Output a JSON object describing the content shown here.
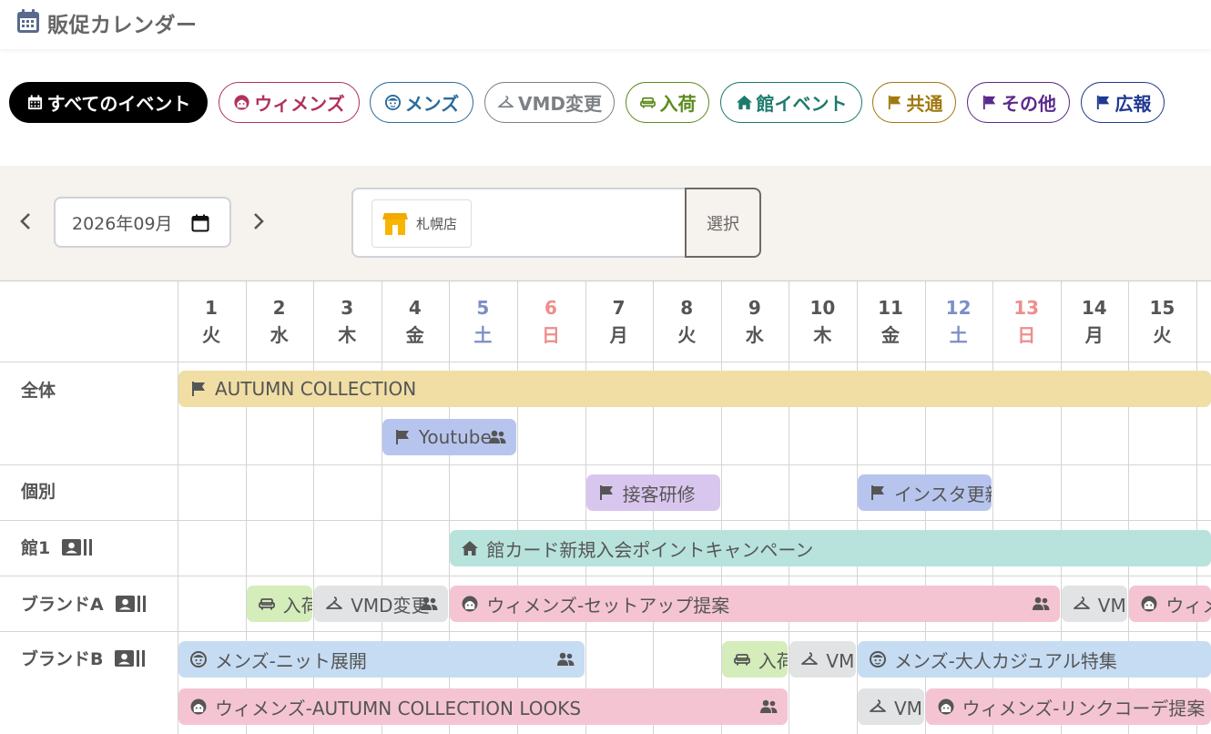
{
  "header": {
    "title": "販促カレンダー",
    "icon": "calendar-icon"
  },
  "filters": [
    {
      "label": "すべてのイベント",
      "icon": "calendar-icon",
      "color": "#000000",
      "active": true
    },
    {
      "label": "ウィメンズ",
      "icon": "woman-face-icon",
      "color": "#b0325f"
    },
    {
      "label": "メンズ",
      "icon": "man-face-icon",
      "color": "#2a6c9e"
    },
    {
      "label": "VMD変更",
      "icon": "hanger-icon",
      "color": "#7d8185"
    },
    {
      "label": "入荷",
      "icon": "sofa-icon",
      "color": "#5c8a1e"
    },
    {
      "label": "館イベント",
      "icon": "house-icon",
      "color": "#1d7a6c"
    },
    {
      "label": "共通",
      "icon": "flag-icon",
      "color": "#a07a10"
    },
    {
      "label": "その他",
      "icon": "flag-icon",
      "color": "#5b2a8c"
    },
    {
      "label": "広報",
      "icon": "flag-icon",
      "color": "#203a90"
    }
  ],
  "toolbar": {
    "month": "2026年09月",
    "store": "札幌店",
    "select_label": "選択"
  },
  "days": [
    {
      "num": "1",
      "dow": "火",
      "type": "weekday"
    },
    {
      "num": "2",
      "dow": "水",
      "type": "weekday"
    },
    {
      "num": "3",
      "dow": "木",
      "type": "weekday"
    },
    {
      "num": "4",
      "dow": "金",
      "type": "weekday"
    },
    {
      "num": "5",
      "dow": "土",
      "type": "sat"
    },
    {
      "num": "6",
      "dow": "日",
      "type": "sun"
    },
    {
      "num": "7",
      "dow": "月",
      "type": "weekday"
    },
    {
      "num": "8",
      "dow": "火",
      "type": "weekday"
    },
    {
      "num": "9",
      "dow": "水",
      "type": "weekday"
    },
    {
      "num": "10",
      "dow": "木",
      "type": "weekday"
    },
    {
      "num": "11",
      "dow": "金",
      "type": "weekday"
    },
    {
      "num": "12",
      "dow": "土",
      "type": "sat"
    },
    {
      "num": "13",
      "dow": "日",
      "type": "sun"
    },
    {
      "num": "14",
      "dow": "月",
      "type": "weekday"
    },
    {
      "num": "15",
      "dow": "火",
      "type": "weekday"
    }
  ],
  "rows": [
    {
      "label": "全体",
      "has_icon": false
    },
    {
      "label": "個別",
      "has_icon": false
    },
    {
      "label": "館1",
      "has_icon": true
    },
    {
      "label": "ブランドA",
      "has_icon": true
    },
    {
      "label": "ブランドB",
      "has_icon": true
    }
  ],
  "events": [
    {
      "row": 0,
      "lane": 0,
      "start": 1,
      "end": 16,
      "label": "AUTUMN COLLECTION",
      "icon": "flag-icon",
      "color": "#f0dea4",
      "people": false
    },
    {
      "row": 0,
      "lane": 1,
      "start": 4,
      "end": 5,
      "label": "Youtube",
      "icon": "flag-icon",
      "color": "#b7c5ee",
      "people": true
    },
    {
      "row": 1,
      "lane": 0,
      "start": 7,
      "end": 8,
      "label": "接客研修",
      "icon": "flag-icon",
      "color": "#d9c6ee",
      "people": false
    },
    {
      "row": 1,
      "lane": 0,
      "start": 11,
      "end": 12,
      "label": "インスタ更新",
      "icon": "flag-icon",
      "color": "#b7c5ee",
      "people": false
    },
    {
      "row": 2,
      "lane": 0,
      "start": 5,
      "end": 16,
      "label": "館カード新規入会ポイントキャンペーン",
      "icon": "house-icon",
      "color": "#b8e3dd",
      "people": false
    },
    {
      "row": 3,
      "lane": 0,
      "start": 2,
      "end": 2,
      "label": "入荷",
      "icon": "sofa-icon",
      "color": "#d4edbb",
      "people": false
    },
    {
      "row": 3,
      "lane": 0,
      "start": 3,
      "end": 4,
      "label": "VMD変更",
      "icon": "hanger-icon",
      "color": "#e2e3e5",
      "people": true
    },
    {
      "row": 3,
      "lane": 0,
      "start": 5,
      "end": 13,
      "label": "ウィメンズ-セットアップ提案",
      "icon": "woman-face-icon",
      "color": "#f5c4d3",
      "people": true
    },
    {
      "row": 3,
      "lane": 0,
      "start": 14,
      "end": 14,
      "label": "VMD変更",
      "icon": "hanger-icon",
      "color": "#e2e3e5",
      "people": false
    },
    {
      "row": 3,
      "lane": 0,
      "start": 15,
      "end": 16,
      "label": "ウィメンズ",
      "icon": "woman-face-icon",
      "color": "#f5c4d3",
      "people": false
    },
    {
      "row": 4,
      "lane": 0,
      "start": 1,
      "end": 6,
      "label": "メンズ-ニット展開",
      "icon": "man-face-icon",
      "color": "#c6dcf3",
      "people": true
    },
    {
      "row": 4,
      "lane": 0,
      "start": 9,
      "end": 9,
      "label": "入荷",
      "icon": "sofa-icon",
      "color": "#d4edbb",
      "people": false
    },
    {
      "row": 4,
      "lane": 0,
      "start": 10,
      "end": 10,
      "label": "VMD変更",
      "icon": "hanger-icon",
      "color": "#e2e3e5",
      "people": false
    },
    {
      "row": 4,
      "lane": 0,
      "start": 11,
      "end": 16,
      "label": "メンズ-大人カジュアル特集",
      "icon": "man-face-icon",
      "color": "#c6dcf3",
      "people": false
    },
    {
      "row": 4,
      "lane": 1,
      "start": 1,
      "end": 9,
      "label": "ウィメンズ-AUTUMN COLLECTION LOOKS",
      "icon": "woman-face-icon",
      "color": "#f5c4d3",
      "people": true
    },
    {
      "row": 4,
      "lane": 1,
      "start": 11,
      "end": 11,
      "label": "VMD変更",
      "icon": "hanger-icon",
      "color": "#e2e3e5",
      "people": false
    },
    {
      "row": 4,
      "lane": 1,
      "start": 12,
      "end": 16,
      "label": "ウィメンズ-リンクコーデ提案",
      "icon": "woman-face-icon",
      "color": "#f5c4d3",
      "people": false
    }
  ]
}
